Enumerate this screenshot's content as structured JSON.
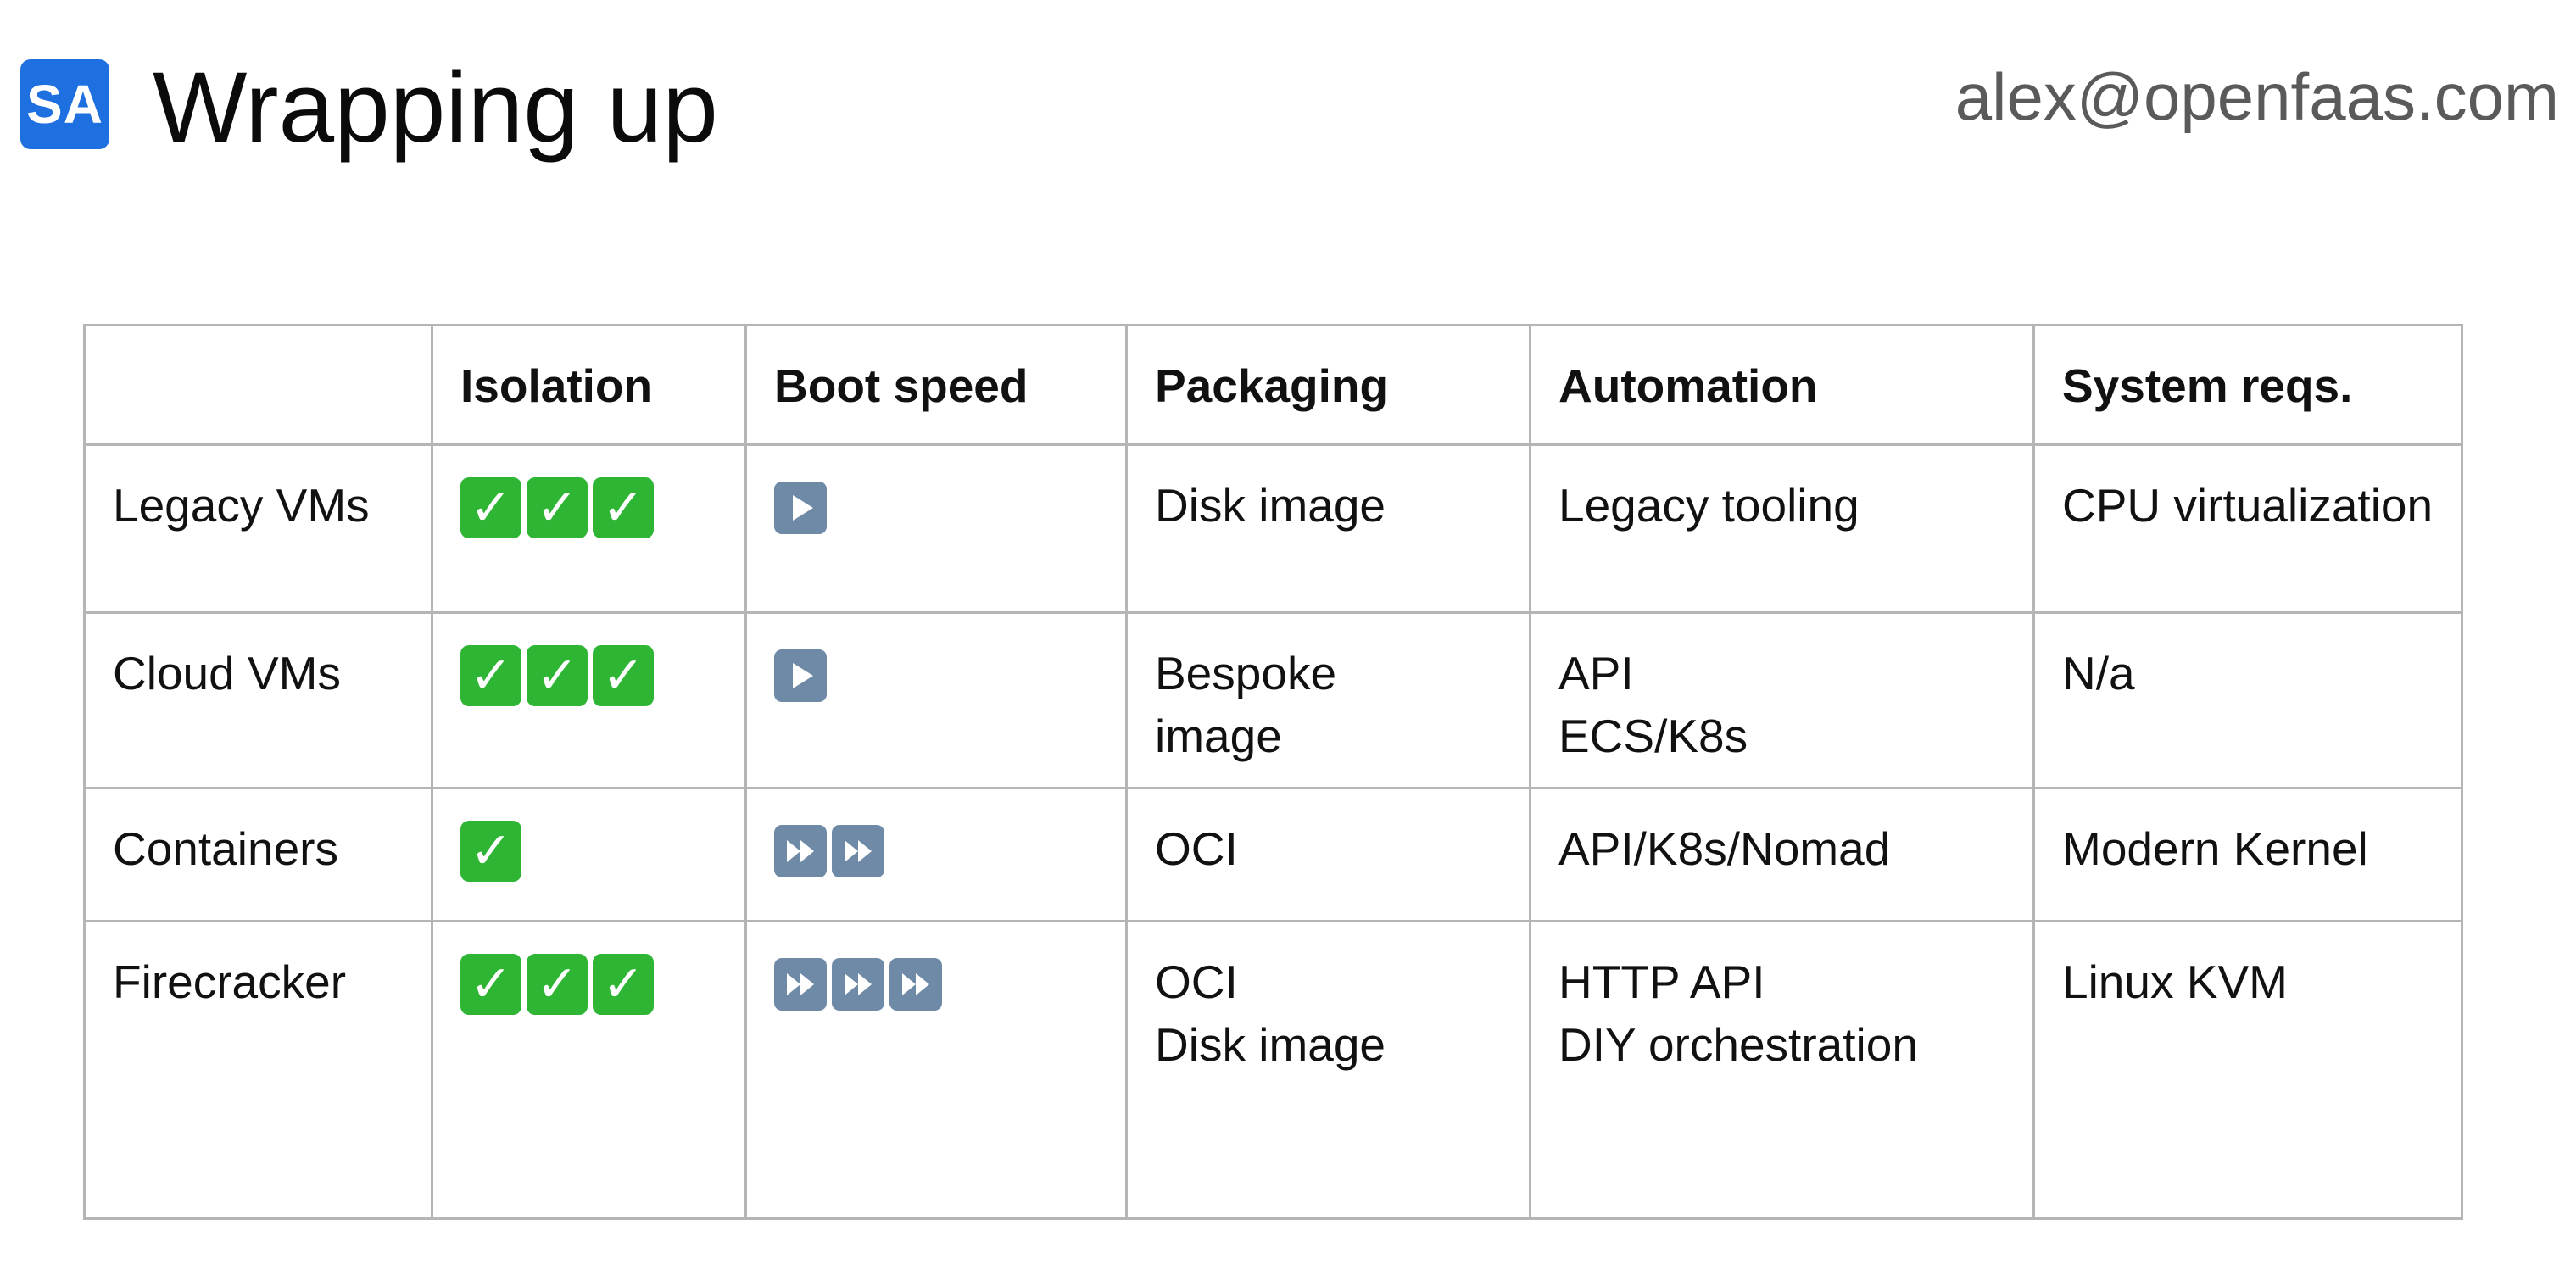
{
  "header": {
    "logo_text": "SA",
    "title": "Wrapping up",
    "email": "alex@openfaas.com"
  },
  "colors": {
    "logo_bg": "#1e6fe0",
    "check_bg": "#2fb534",
    "speed_icon_bg": "#6f8aa6",
    "grid": "#b5b5b5",
    "email_text": "#5a5a5a"
  },
  "table": {
    "headers": [
      "",
      "Isolation",
      "Boot speed",
      "Packaging",
      "Automation",
      "System reqs."
    ],
    "rows": [
      {
        "name": "Legacy VMs",
        "isolation_checks": 3,
        "boot_speed": {
          "icon": "play-button-icon",
          "count": 1
        },
        "packaging": [
          "Disk image"
        ],
        "automation": [
          "Legacy tooling"
        ],
        "system_reqs": [
          "CPU virtualization"
        ]
      },
      {
        "name": "Cloud VMs",
        "isolation_checks": 3,
        "boot_speed": {
          "icon": "play-button-icon",
          "count": 1
        },
        "packaging": [
          "Bespoke",
          "image"
        ],
        "automation": [
          "API",
          "ECS/K8s"
        ],
        "system_reqs": [
          "N/a"
        ]
      },
      {
        "name": "Containers",
        "isolation_checks": 1,
        "boot_speed": {
          "icon": "fast-forward-icon",
          "count": 2
        },
        "packaging": [
          "OCI"
        ],
        "automation": [
          "API/K8s/Nomad"
        ],
        "system_reqs": [
          "Modern Kernel"
        ]
      },
      {
        "name": "Firecracker",
        "isolation_checks": 3,
        "boot_speed": {
          "icon": "fast-forward-icon",
          "count": 3
        },
        "packaging": [
          "OCI",
          "Disk image"
        ],
        "automation": [
          "HTTP API",
          "DIY orchestration"
        ],
        "system_reqs": [
          "Linux KVM"
        ]
      }
    ]
  }
}
